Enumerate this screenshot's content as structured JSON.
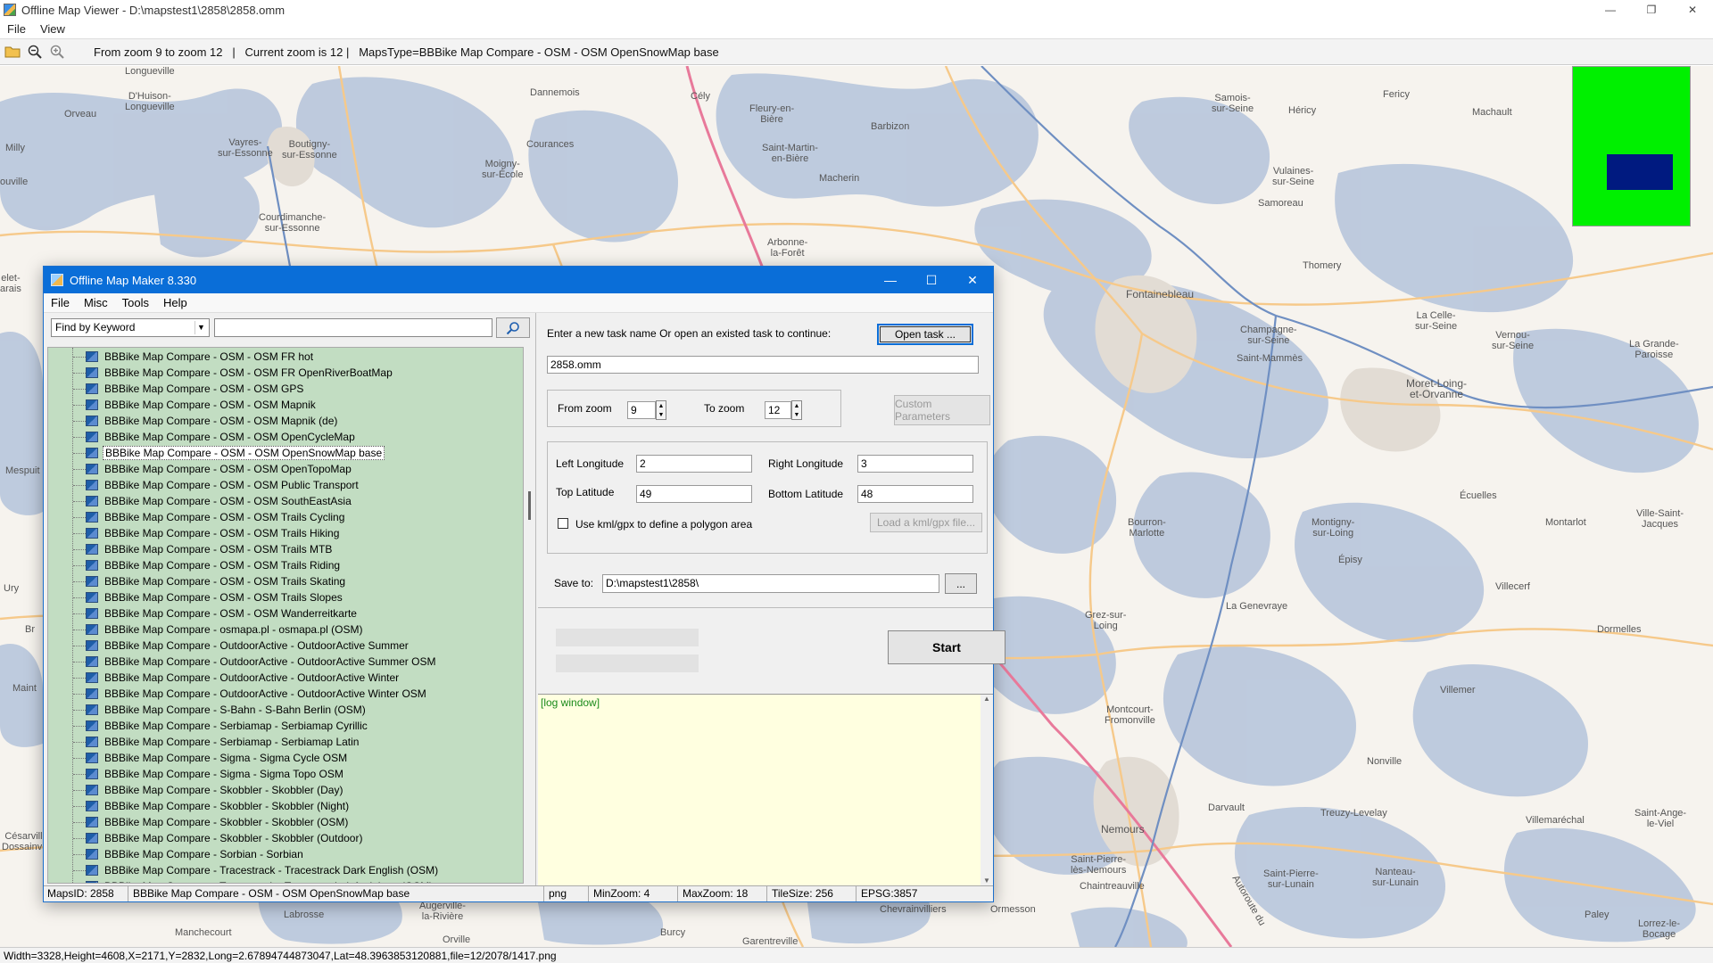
{
  "viewer": {
    "title": "Offline Map Viewer - D:\\mapstest1\\2858\\2858.omm",
    "menu": [
      "File",
      "View"
    ],
    "toolbar_status": "From zoom 9 to zoom 12   |   Current zoom is 12 |   MapsType=BBBike Map Compare - OSM - OSM OpenSnowMap base",
    "statusbar": "Width=3328,Height=4608,X=2171,Y=2832,Long=2.67894744873047,Lat=48.3963853120881,file=12/2078/1417.png",
    "towns": [
      "Longueville",
      "D'Huison-\nLongueville",
      "Orveau",
      "Vayres-\nsur-Essonne",
      "Boutigny-\nsur-Essonne",
      "Courdimanche-\nsur-Essonne",
      "ouville",
      "Dannemois",
      "Courances",
      "Moigny-\nsur-École",
      "Cély",
      "Fleury-en-\nBière",
      "Saint-Martin-\nen-Bière",
      "Barbizon",
      "Macherin",
      "Arbonne-\nla-Forêt",
      "Samois-\nsur-Seine",
      "Héricy",
      "Fericy",
      "Machault",
      "Vulaines-\nsur-Seine",
      "Samoreau",
      "Fontainebleau",
      "Thomery",
      "Champagne-\nsur-Seine",
      "La Celle-\nsur-Seine",
      "Vernou-\nsur-Seine",
      "Saint-Mammès",
      "Moret-Loing-\net-Orvanne",
      "La Grande-\nParoisse",
      "Écuelles",
      "Bourron-\nMarlotte",
      "Montigny-\nsur-Loing",
      "Montarlot",
      "Ville-Saint-\nJacques",
      "Épisy",
      "Villecerf",
      "Grez-sur-\nLoing",
      "La Genevraye",
      "Dormelles",
      "Montcourt-\nFromonville",
      "Villemer",
      "Nonville",
      "Darvault",
      "Treuzy-Levelay",
      "Villemaréchal",
      "Saint-Ange-\nle-Viel",
      "Nemours",
      "Saint-Pierre-\nlès-Nemours",
      "Chaintreauville",
      "Saint-Pierre-\nsur-Lunain",
      "Nanteau-\nsur-Lunain",
      "Paley",
      "Lorrez-le-\nBocage",
      "Mespuit",
      "Maint",
      "Br",
      "Césarville-\nDossainville",
      "Manchecourt",
      "Labrosse",
      "Augerville-\nla-Rivière",
      "Orville",
      "Burcy",
      "Garentreville",
      "Chevrainvilliers",
      "Ormesson",
      "Autoroute du",
      "Milly",
      "elet-\narais",
      "Ury"
    ]
  },
  "minimap": {
    "background": "#00f000",
    "marker": "#001a80"
  },
  "maker": {
    "title": "Offline Map Maker 8.330",
    "menu": [
      "File",
      "Misc",
      "Tools",
      "Help"
    ],
    "find_mode": "Find by Keyword",
    "keyword_value": "",
    "tree_items": [
      "BBBike Map Compare - OSM - OSM FR hot",
      "BBBike Map Compare - OSM - OSM FR OpenRiverBoatMap",
      "BBBike Map Compare - OSM - OSM GPS",
      "BBBike Map Compare - OSM - OSM Mapnik",
      "BBBike Map Compare - OSM - OSM Mapnik (de)",
      "BBBike Map Compare - OSM - OSM OpenCycleMap",
      "BBBike Map Compare - OSM - OSM OpenSnowMap base",
      "BBBike Map Compare - OSM - OSM OpenTopoMap",
      "BBBike Map Compare - OSM - OSM Public Transport",
      "BBBike Map Compare - OSM - OSM SouthEastAsia",
      "BBBike Map Compare - OSM - OSM Trails Cycling",
      "BBBike Map Compare - OSM - OSM Trails Hiking",
      "BBBike Map Compare - OSM - OSM Trails MTB",
      "BBBike Map Compare - OSM - OSM Trails Riding",
      "BBBike Map Compare - OSM - OSM Trails Skating",
      "BBBike Map Compare - OSM - OSM Trails Slopes",
      "BBBike Map Compare - OSM - OSM Wanderreitkarte",
      "BBBike Map Compare - osmapa.pl - osmapa.pl (OSM)",
      "BBBike Map Compare - OutdoorActive - OutdoorActive Summer",
      "BBBike Map Compare - OutdoorActive - OutdoorActive Summer OSM",
      "BBBike Map Compare - OutdoorActive - OutdoorActive Winter",
      "BBBike Map Compare - OutdoorActive - OutdoorActive Winter OSM",
      "BBBike Map Compare - S-Bahn - S-Bahn Berlin (OSM)",
      "BBBike Map Compare - Serbiamap - Serbiamap Cyrillic",
      "BBBike Map Compare - Serbiamap - Serbiamap Latin",
      "BBBike Map Compare - Sigma - Sigma Cycle OSM",
      "BBBike Map Compare - Sigma - Sigma Topo OSM",
      "BBBike Map Compare - Skobbler - Skobbler (Day)",
      "BBBike Map Compare - Skobbler - Skobbler (Night)",
      "BBBike Map Compare - Skobbler - Skobbler (OSM)",
      "BBBike Map Compare - Skobbler - Skobbler (Outdoor)",
      "BBBike Map Compare - Sorbian - Sorbian",
      "BBBike Map Compare - Tracestrack - Tracestrack Dark English (OSM)",
      "BBBike Map Compare - Tracestrack - Tracestrack default lang (OSM)"
    ],
    "selected_index": 6,
    "task_prompt": "Enter a new task name Or open an existed task to continue:",
    "open_task_label": "Open task ...",
    "task_name": "2858.omm",
    "from_zoom_label": "From zoom",
    "from_zoom": "9",
    "to_zoom_label": "To zoom",
    "to_zoom": "12",
    "custom_params_label": "Custom Parameters",
    "left_lon_label": "Left Longitude",
    "left_lon": "2",
    "right_lon_label": "Right Longitude",
    "right_lon": "3",
    "top_lat_label": "Top Latitude",
    "top_lat": "49",
    "bottom_lat_label": "Bottom Latitude",
    "bottom_lat": "48",
    "kml_label": "Use kml/gpx to define a polygon area",
    "load_kml_label": "Load a kml/gpx file...",
    "save_to_label": "Save to:",
    "save_to": "D:\\mapstest1\\2858\\",
    "browse_label": "...",
    "start_label": "Start",
    "log_text": "[log window]",
    "status": {
      "maps_id": "MapsID: 2858",
      "maps_name": "BBBike Map Compare - OSM - OSM OpenSnowMap base",
      "format": "png",
      "min_zoom": "MinZoom: 4",
      "max_zoom": "MaxZoom: 18",
      "tile_size": "TileSize: 256",
      "epsg": "EPSG:3857"
    }
  }
}
